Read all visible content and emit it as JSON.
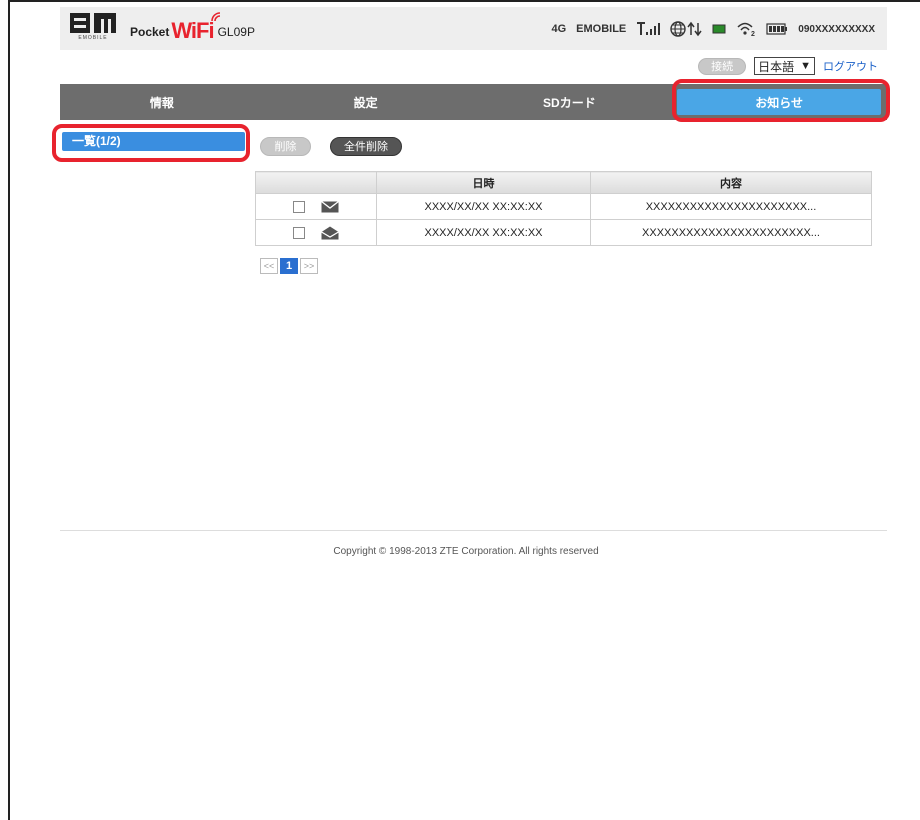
{
  "header": {
    "logo_sub": "EMOBILE",
    "brand_pocket": "Pocket",
    "brand_wifi": "WiFi",
    "model": "GL09P",
    "network_type": "4G",
    "carrier": "EMOBILE",
    "phone_number": "090XXXXXXXXX"
  },
  "controls": {
    "connect_label": "接続",
    "language_value": "日本語",
    "logout_label": "ログアウト"
  },
  "nav": {
    "items": [
      {
        "label": "情報"
      },
      {
        "label": "設定"
      },
      {
        "label": "SDカード"
      },
      {
        "label": "お知らせ"
      }
    ],
    "active_index": 3
  },
  "sidebar": {
    "items": [
      {
        "label": "一覧(1/2)"
      }
    ]
  },
  "actions": {
    "delete_label": "削除",
    "delete_all_label": "全件削除"
  },
  "table": {
    "headers": [
      "",
      "日時",
      "内容"
    ],
    "rows": [
      {
        "icon": "mail-unread-icon",
        "datetime": "XXXX/XX/XX XX:XX:XX",
        "content": "XXXXXXXXXXXXXXXXXXXXXX..."
      },
      {
        "icon": "mail-read-icon",
        "datetime": "XXXX/XX/XX XX:XX:XX",
        "content": "XXXXXXXXXXXXXXXXXXXXXXX..."
      }
    ]
  },
  "pager": {
    "prev": "<<",
    "current": "1",
    "next": ">>"
  },
  "footer": {
    "copyright": "Copyright © 1998-2013 ZTE Corporation. All rights reserved"
  },
  "colors": {
    "accent": "#4aa6e6",
    "nav_bg": "#6d6d6d",
    "highlight_red": "#e8232e",
    "brand_red": "#e8232e"
  }
}
